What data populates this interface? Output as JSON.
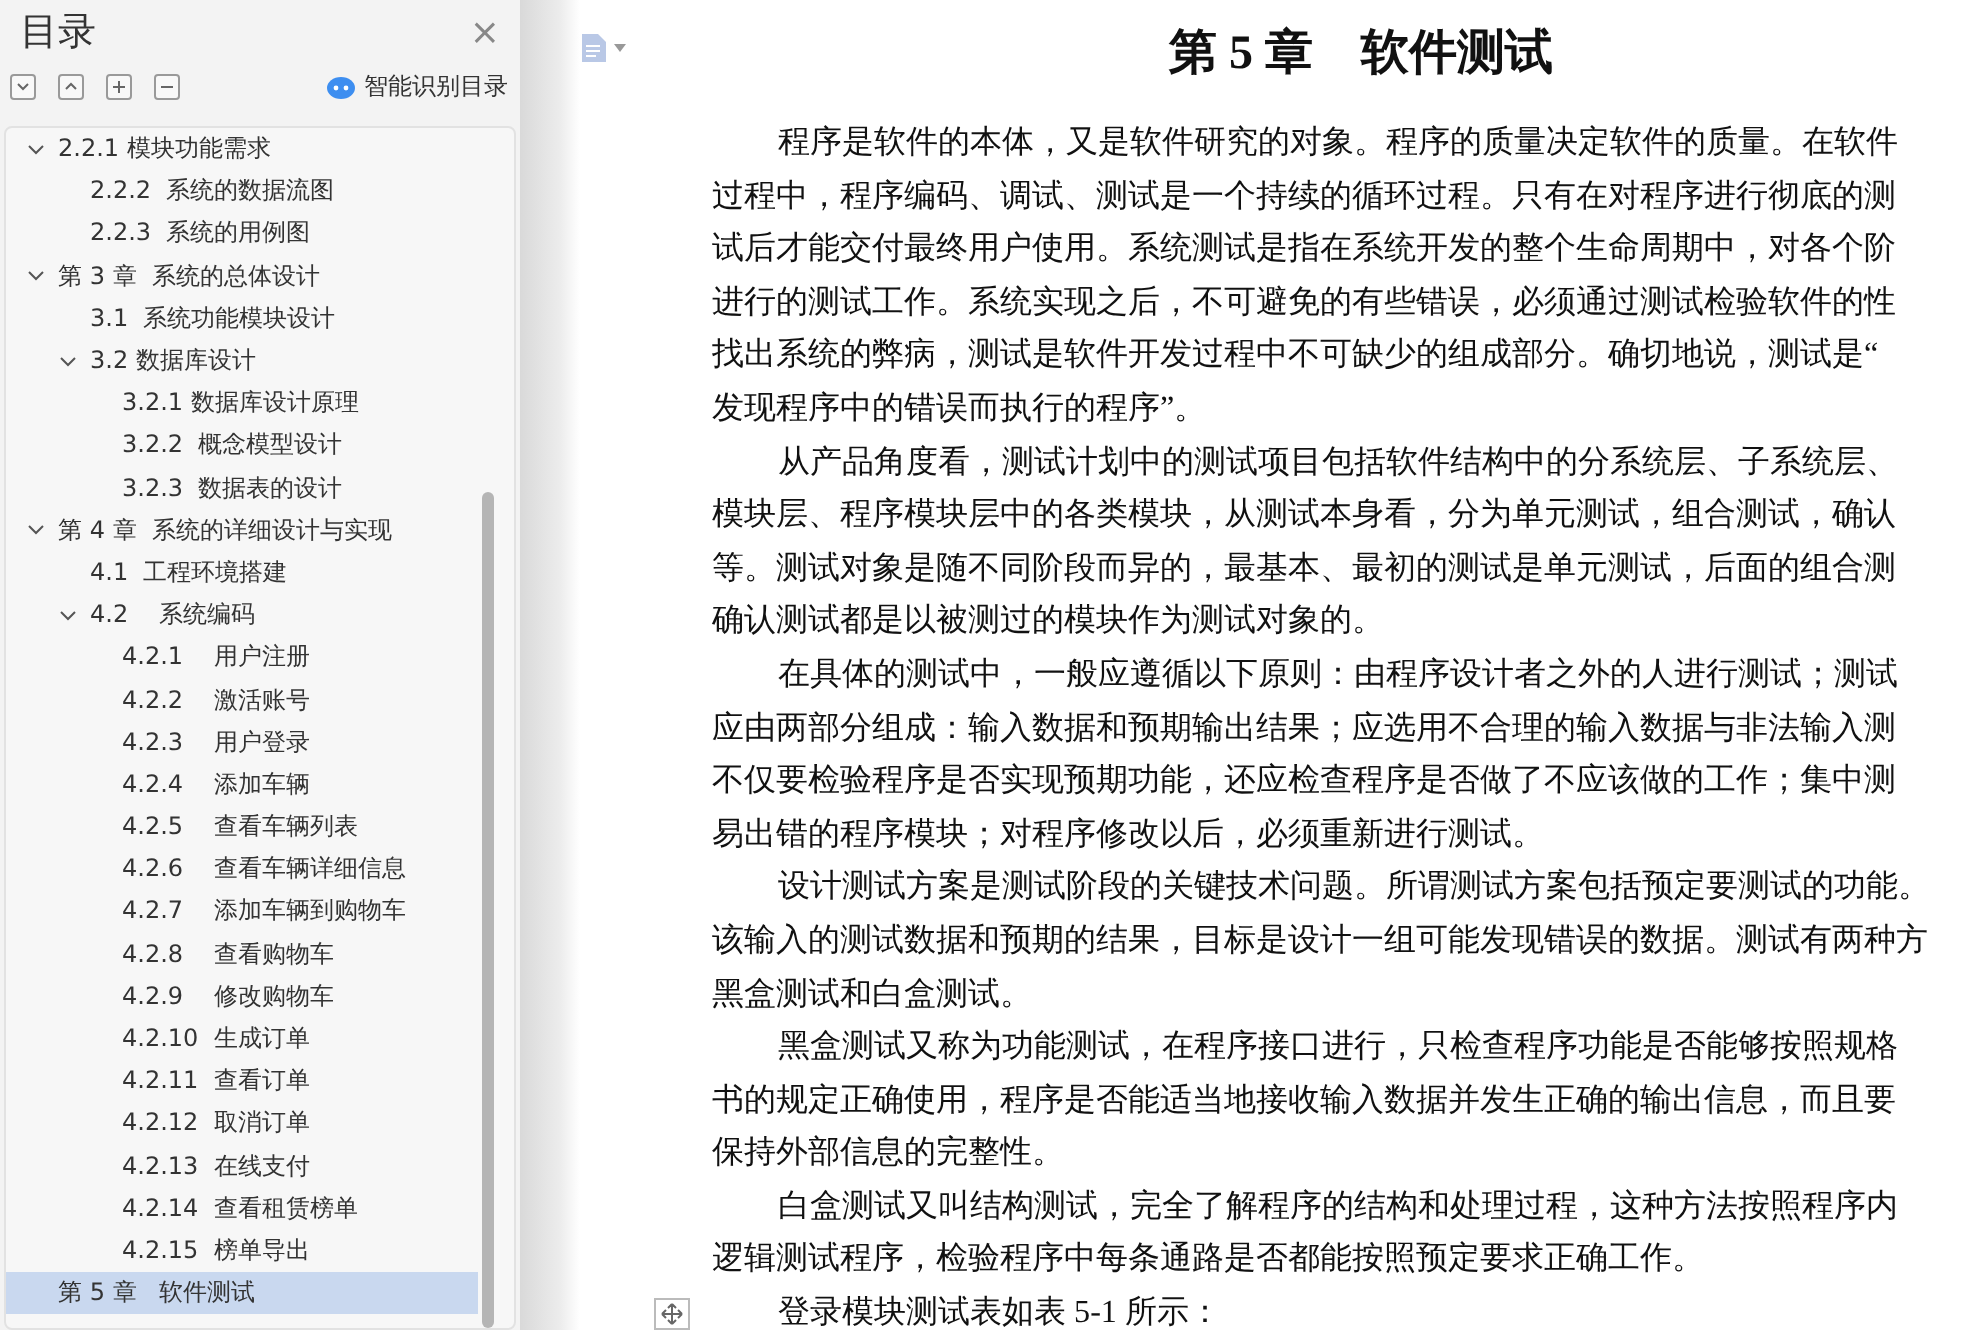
{
  "sidebar": {
    "title": "目录",
    "close": "×",
    "smart_button": "智能识别目录",
    "tree": [
      {
        "label": "2.2.1 模块功能需求",
        "selected": false,
        "expanded": true,
        "children": [
          {
            "label": "2.2.2  系统的数据流图",
            "selected": false
          },
          {
            "label": "2.2.3  系统的用例图",
            "selected": false
          }
        ]
      },
      {
        "label": "第 3 章  系统的总体设计",
        "selected": false,
        "expanded": true,
        "children": [
          {
            "label": "3.1  系统功能模块设计",
            "selected": false
          },
          {
            "label": "3.2 数据库设计",
            "selected": false,
            "expanded": true,
            "children": [
              {
                "label": "3.2.1 数据库设计原理",
                "selected": false
              },
              {
                "label": "3.2.2  概念模型设计",
                "selected": false
              },
              {
                "label": "3.2.3  数据表的设计",
                "selected": false
              }
            ]
          }
        ]
      },
      {
        "label": "第 4 章  系统的详细设计与实现",
        "selected": false,
        "expanded": true,
        "children": [
          {
            "label": "4.1  工程环境搭建",
            "selected": false
          },
          {
            "label": "4.2    系统编码",
            "selected": false,
            "expanded": true,
            "children": [
              {
                "label": "4.2.1    用户注册",
                "selected": false
              },
              {
                "label": "4.2.2    激活账号",
                "selected": false
              },
              {
                "label": "4.2.3    用户登录",
                "selected": false
              },
              {
                "label": "4.2.4    添加车辆",
                "selected": false
              },
              {
                "label": "4.2.5    查看车辆列表",
                "selected": false
              },
              {
                "label": "4.2.6    查看车辆详细信息",
                "selected": false
              },
              {
                "label": "4.2.7    添加车辆到购物车",
                "selected": false
              },
              {
                "label": "4.2.8    查看购物车",
                "selected": false
              },
              {
                "label": "4.2.9    修改购物车",
                "selected": false
              },
              {
                "label": "4.2.10  生成订单",
                "selected": false
              },
              {
                "label": "4.2.11  查看订单",
                "selected": false
              },
              {
                "label": "4.2.12  取消订单",
                "selected": false
              },
              {
                "label": "4.2.13  在线支付",
                "selected": false
              },
              {
                "label": "4.2.14  查看租赁榜单",
                "selected": false
              },
              {
                "label": "4.2.15  榜单导出",
                "selected": false
              }
            ]
          }
        ]
      },
      {
        "label": "第 5 章   软件测试",
        "selected": true
      }
    ]
  },
  "document": {
    "chapter_title": "第 5 章　软件测试",
    "paragraphs": [
      {
        "lines": [
          "程序是软件的本体，又是软件研究的对象。程序的质量决定软件的质量。在软件",
          "过程中，程序编码、调试、测试是一个持续的循环过程。只有在对程序进行彻底的测",
          "试后才能交付最终用户使用。系统测试是指在系统开发的整个生命周期中，对各个阶",
          "进行的测试工作。系统实现之后，不可避免的有些错误，必须通过测试检验软件的性",
          "找出系统的弊病，测试是软件开发过程中不可缺少的组成部分。确切地说，测试是“",
          "发现程序中的错误而执行的程序”。"
        ]
      },
      {
        "lines": [
          "从产品角度看，测试计划中的测试项目包括软件结构中的分系统层、子系统层、",
          "模块层、程序模块层中的各类模块，从测试本身看，分为单元测试，组合测试，确认",
          "等。测试对象是随不同阶段而异的，最基本、最初的测试是单元测试，后面的组合测",
          "确认测试都是以被测过的模块作为测试对象的。"
        ]
      },
      {
        "lines": [
          "在具体的测试中，一般应遵循以下原则：由程序设计者之外的人进行测试；测试",
          "应由两部分组成：输入数据和预期输出结果；应选用不合理的输入数据与非法输入测",
          "不仅要检验程序是否实现预期功能，还应检查程序是否做了不应该做的工作；集中测",
          "易出错的程序模块；对程序修改以后，必须重新进行测试。"
        ]
      },
      {
        "lines": [
          "设计测试方案是测试阶段的关键技术问题。所谓测试方案包括预定要测试的功能。",
          "该输入的测试数据和预期的结果，目标是设计一组可能发现错误的数据。测试有两种方",
          "黑盒测试和白盒测试。"
        ]
      },
      {
        "lines": [
          "黑盒测试又称为功能测试，在程序接口进行，只检查程序功能是否能够按照规格",
          "书的规定正确使用，程序是否能适当地接收输入数据并发生正确的输出信息，而且要",
          "保持外部信息的完整性。"
        ]
      },
      {
        "lines": [
          "白盒测试又叫结构测试，完全了解程序的结构和处理过程，这种方法按照程序内",
          "逻辑测试程序，检验程序中每条通路是否都能按照预定要求正确工作。"
        ]
      },
      {
        "lines": [
          "登录模块测试表如表 5-1 所示："
        ]
      }
    ]
  }
}
